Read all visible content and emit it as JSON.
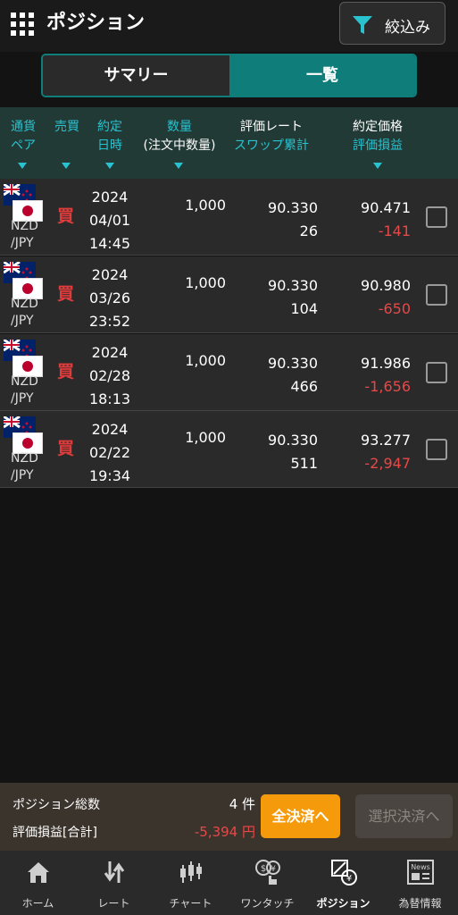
{
  "header": {
    "title": "ポジション",
    "filter_label": "絞込み"
  },
  "tabs": {
    "summary": "サマリー",
    "list": "一覧"
  },
  "columns": {
    "pair_l1": "通貨",
    "pair_l2": "ペア",
    "side": "売買",
    "date_l1": "約定",
    "date_l2": "日時",
    "qty_l1": "数量",
    "qty_l2": "(注文中数量)",
    "rate_l1": "評価レート",
    "rate_l2": "スワップ累計",
    "price_l1": "約定価格",
    "price_l2": "評価損益"
  },
  "rows": [
    {
      "pair_l1": "NZD",
      "pair_l2": "/JPY",
      "side": "買",
      "year": "2024",
      "date": "04/01",
      "time": "14:45",
      "qty": "1,000",
      "rate": "90.330",
      "swap": "26",
      "price": "90.471",
      "pl": "-141"
    },
    {
      "pair_l1": "NZD",
      "pair_l2": "/JPY",
      "side": "買",
      "year": "2024",
      "date": "03/26",
      "time": "23:52",
      "qty": "1,000",
      "rate": "90.330",
      "swap": "104",
      "price": "90.980",
      "pl": "-650"
    },
    {
      "pair_l1": "NZD",
      "pair_l2": "/JPY",
      "side": "買",
      "year": "2024",
      "date": "02/28",
      "time": "18:13",
      "qty": "1,000",
      "rate": "90.330",
      "swap": "466",
      "price": "91.986",
      "pl": "-1,656"
    },
    {
      "pair_l1": "NZD",
      "pair_l2": "/JPY",
      "side": "買",
      "year": "2024",
      "date": "02/22",
      "time": "19:34",
      "qty": "1,000",
      "rate": "90.330",
      "swap": "511",
      "price": "93.277",
      "pl": "-2,947"
    }
  ],
  "summary": {
    "count_label": "ポジション総数",
    "count_value": "4 件",
    "pl_label": "評価損益[合計]",
    "pl_value": "-5,394 円",
    "close_all": "全決済へ",
    "close_selected": "選択決済へ"
  },
  "nav": {
    "home": "ホーム",
    "rate": "レート",
    "chart": "チャート",
    "onetouch": "ワンタッチ",
    "position": "ポジション",
    "news": "為替情報",
    "news_icon_text": "News"
  },
  "colors": {
    "accent": "#0f7d7a",
    "teal_text": "#29c2cf",
    "loss": "#e84848",
    "buy": "#e23b3b",
    "close_all_btn": "#f59a0a"
  }
}
